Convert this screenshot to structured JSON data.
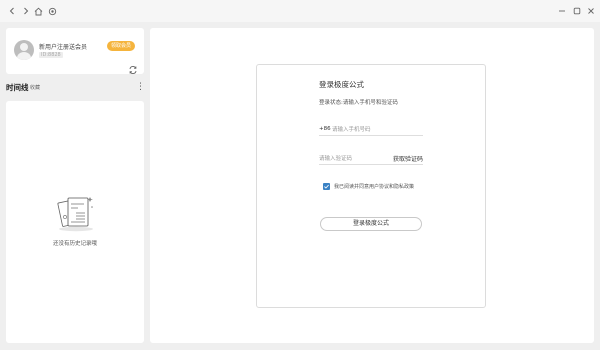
{
  "titlebar": {
    "icons": [
      "back-icon",
      "forward-icon",
      "home-icon",
      "settings-icon",
      "minimize-icon",
      "maximize-icon",
      "close-icon"
    ]
  },
  "user": {
    "name": "新用户注册送会员",
    "id": "ID:8828",
    "vip_badge": "领取会员"
  },
  "timeline": {
    "title": "时间线",
    "subtitle": "收藏"
  },
  "history": {
    "empty_text": "还没有历史记录哦"
  },
  "login": {
    "title": "登录极度公式",
    "hint": "登录状态:请输入手机号和验证码",
    "phone_prefix": "+86",
    "phone_placeholder": "请输入手机号码",
    "code_placeholder": "请输入验证码",
    "get_code": "获取验证码",
    "agree_text": "我已阅读并同意用户协议和隐私政策",
    "agree_checked": true,
    "button": "登录极度公式"
  },
  "colors": {
    "accent": "#3b82c4",
    "vip": "#f5b43d",
    "background": "#efefef",
    "panel": "#ffffff"
  }
}
